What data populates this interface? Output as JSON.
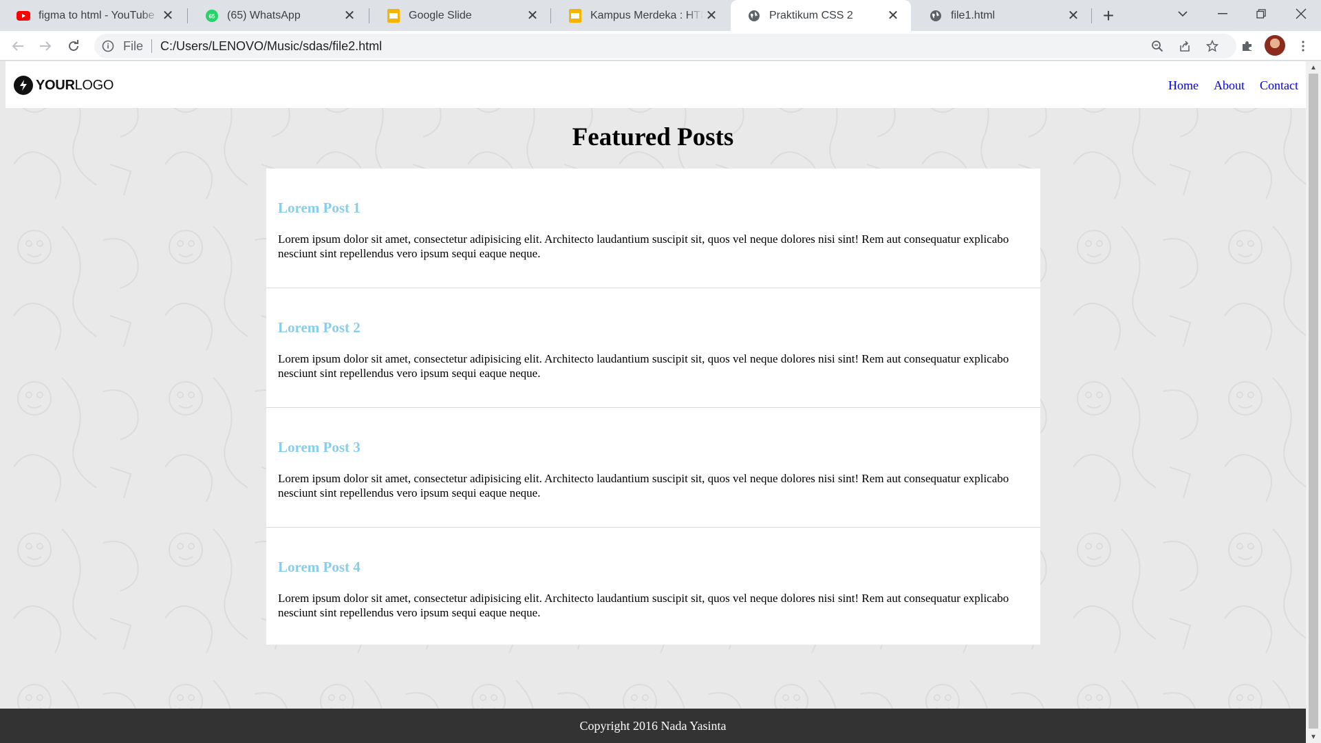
{
  "browser": {
    "tabs": [
      {
        "title": "figma to html - YouTube",
        "icon": "youtube-icon",
        "active": false
      },
      {
        "title": "(65) WhatsApp",
        "icon": "whatsapp-icon",
        "active": false,
        "badge": "65"
      },
      {
        "title": "Google Slide",
        "icon": "google-slides-icon",
        "active": false
      },
      {
        "title": "Kampus Merdeka : HTML & CSS",
        "icon": "google-slides-icon",
        "active": false
      },
      {
        "title": "Praktikum CSS 2",
        "icon": "globe-icon",
        "active": true
      },
      {
        "title": "file1.html",
        "icon": "globe-icon",
        "active": false
      }
    ],
    "address": {
      "scheme": "File",
      "url": "C:/Users/LENOVO/Music/sdas/file2.html"
    }
  },
  "site": {
    "logo_bold": "YOUR",
    "logo_light": "LOGO",
    "nav": [
      "Home",
      "About",
      "Contact"
    ],
    "heading": "Featured Posts",
    "posts": [
      {
        "title": "Lorem Post 1",
        "body": "Lorem ipsum dolor sit amet, consectetur adipisicing elit. Architecto laudantium suscipit sit, quos vel neque dolores nisi sint! Rem aut consequatur explicabo nesciunt sint repellendus vero ipsum sequi eaque neque."
      },
      {
        "title": "Lorem Post 2",
        "body": "Lorem ipsum dolor sit amet, consectetur adipisicing elit. Architecto laudantium suscipit sit, quos vel neque dolores nisi sint! Rem aut consequatur explicabo nesciunt sint repellendus vero ipsum sequi eaque neque."
      },
      {
        "title": "Lorem Post 3",
        "body": "Lorem ipsum dolor sit amet, consectetur adipisicing elit. Architecto laudantium suscipit sit, quos vel neque dolores nisi sint! Rem aut consequatur explicabo nesciunt sint repellendus vero ipsum sequi eaque neque."
      },
      {
        "title": "Lorem Post 4",
        "body": "Lorem ipsum dolor sit amet, consectetur adipisicing elit. Architecto laudantium suscipit sit, quos vel neque dolores nisi sint! Rem aut consequatur explicabo nesciunt sint repellendus vero ipsum sequi eaque neque."
      }
    ],
    "footer": "Copyright 2016 Nada Yasinta"
  },
  "colors": {
    "post_title": "#87ceeb",
    "nav_link": "#0000ee",
    "footer_bg": "#333333",
    "page_bg": "#e9e9e9"
  }
}
